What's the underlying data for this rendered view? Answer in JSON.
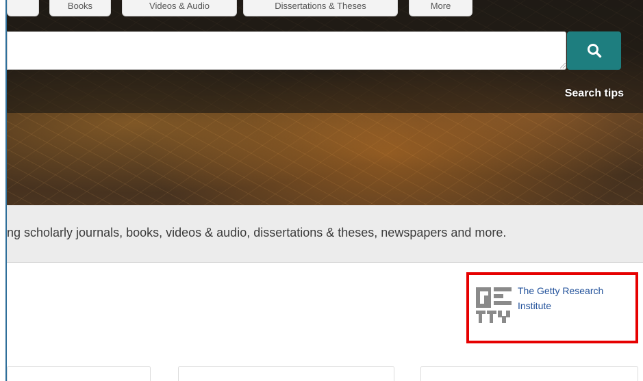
{
  "nav": {
    "tabs": [
      {
        "label": ""
      },
      {
        "label": "Books"
      },
      {
        "label": "Videos & Audio"
      },
      {
        "label": "Dissertations & Theses"
      },
      {
        "label": "More"
      }
    ]
  },
  "search": {
    "value": "",
    "tips_label": "Search tips",
    "button_icon": "search-icon"
  },
  "description": "ng scholarly journals, books, videos & audio, dissertations & theses, newspapers and more.",
  "institution": {
    "name": "The Getty Research Institute",
    "logo_icon": "getty-logo-icon",
    "highlight_color": "#e60000"
  },
  "colors": {
    "accent": "#1e7e7f",
    "link": "#1f4f99"
  }
}
